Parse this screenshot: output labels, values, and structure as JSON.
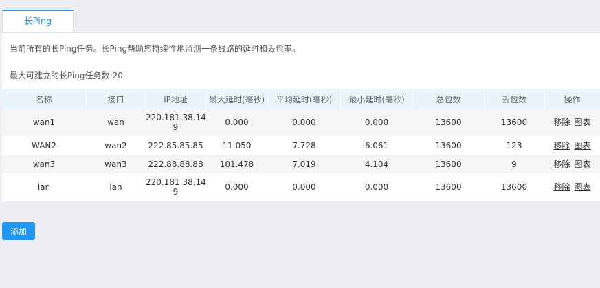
{
  "tab": {
    "label": "长Ping"
  },
  "description": "当前所有的长Ping任务。长Ping帮助您持续性地监测一条线路的延时和丢包率。",
  "limit_text": "最大可建立的长Ping任务数:20",
  "table": {
    "headers": [
      "名称",
      "接口",
      "IP地址",
      "最大延时(毫秒)",
      "平均延时(毫秒)",
      "最小延时(毫秒)",
      "总包数",
      "丢包数",
      "操作"
    ],
    "rows": [
      {
        "name": "wan1",
        "iface": "wan",
        "ip": "220.181.38.14 9",
        "max": "0.000",
        "avg": "0.000",
        "min": "0.000",
        "total": "13600",
        "lost": "13600"
      },
      {
        "name": "WAN2",
        "iface": "wan2",
        "ip": "222.85.85.85",
        "max": "11.050",
        "avg": "7.728",
        "min": "6.061",
        "total": "13600",
        "lost": "123"
      },
      {
        "name": "wan3",
        "iface": "wan3",
        "ip": "222.88.88.88",
        "max": "101.478",
        "avg": "7.019",
        "min": "4.104",
        "total": "13600",
        "lost": "9"
      },
      {
        "name": "lan",
        "iface": "lan",
        "ip": "220.181.38.14 9",
        "max": "0.000",
        "avg": "0.000",
        "min": "0.000",
        "total": "13600",
        "lost": "13600"
      }
    ],
    "actions": {
      "remove": "移除",
      "chart": "图表"
    }
  },
  "add_button": "添加",
  "colors": {
    "accent": "#2f96e8",
    "button": "#2196f3",
    "header_bg": "#e8f3fb"
  }
}
